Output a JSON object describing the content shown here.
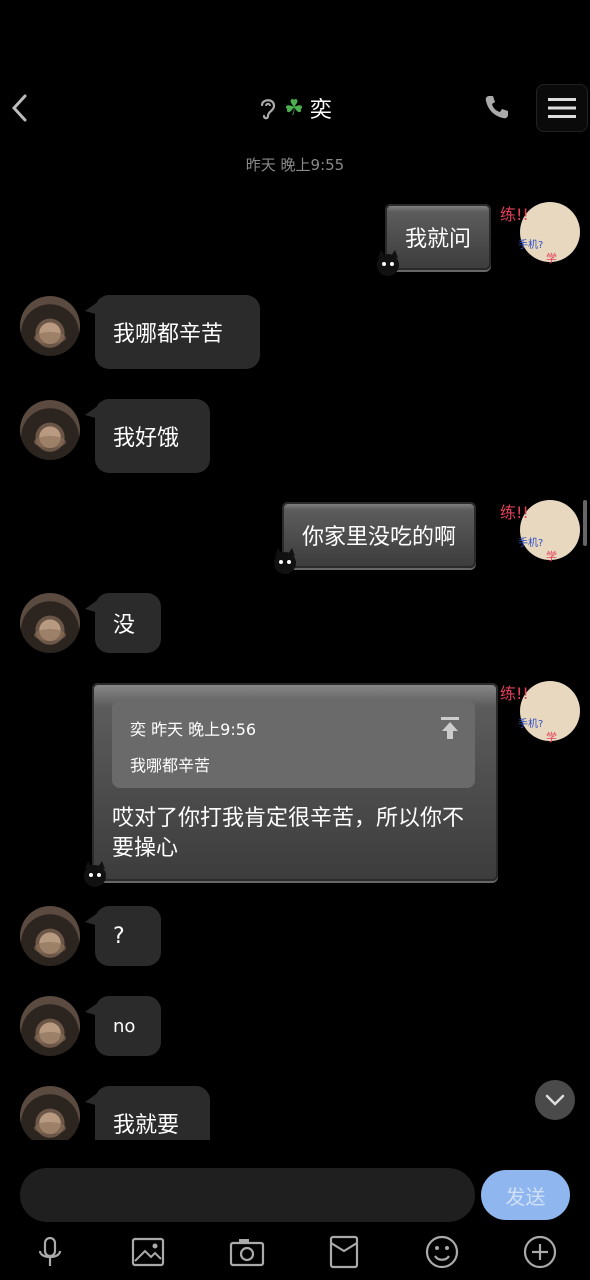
{
  "header": {
    "title": "奕",
    "clover": "☘",
    "icons": [
      "back-arrow-icon",
      "ear-icon",
      "phone-icon",
      "menu-icon"
    ]
  },
  "timestamp": "昨天 晚上9:55",
  "messages": [
    {
      "side": "out",
      "text": "我就问"
    },
    {
      "side": "in",
      "text": "我哪都辛苦"
    },
    {
      "side": "in",
      "text": "我好饿"
    },
    {
      "side": "out",
      "text": "你家里没吃的啊"
    },
    {
      "side": "in",
      "text": "没"
    },
    {
      "side": "out",
      "quote_meta": "奕 昨天 晚上9:56",
      "quote_text": "我哪都辛苦",
      "text": "哎对了你打我肯定很辛苦，所以你不要操心"
    },
    {
      "side": "in",
      "text": "?"
    },
    {
      "side": "in",
      "text": "no"
    },
    {
      "side": "in",
      "text": "我就要"
    }
  ],
  "input": {
    "placeholder": "",
    "send_label": "发送"
  },
  "colors": {
    "accent": "#8fb6ee",
    "bubble_in": "#2b2b2b",
    "background": "#000000"
  }
}
